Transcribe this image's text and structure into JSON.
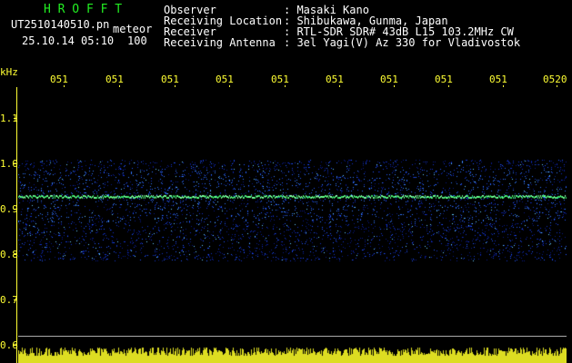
{
  "header": {
    "program": "H R O F F T",
    "filename": "UT2510140510.pn",
    "mode": "meteor",
    "datetime": "25.10.14 05:10",
    "count": "100",
    "info_labels": [
      "Observer",
      "Receiving Location",
      "Receiver",
      "Receiving Antenna"
    ],
    "info_values": [
      ": Masaki Kano",
      ": Shibukawa, Gunma, Japan",
      ": RTL-SDR SDR# 43dB L15 103.2MHz CW",
      ": 3el Yagi(V) Az 330 for Vladivostok"
    ]
  },
  "axis": {
    "unit": "kHz",
    "y_ticks": [
      "1.1",
      "1.0",
      "0.9",
      "0.8",
      "0.7",
      "0.6"
    ],
    "x_ticks": [
      "051",
      "051",
      "051",
      "051",
      "051",
      "051",
      "051",
      "051",
      "051",
      "0520"
    ]
  },
  "colors": {
    "background": "#000000",
    "axis": "#ffff33",
    "title": "#22ee22",
    "text": "#ffffff",
    "signal_line": "#66ff66",
    "noise": "#1133ff"
  }
}
